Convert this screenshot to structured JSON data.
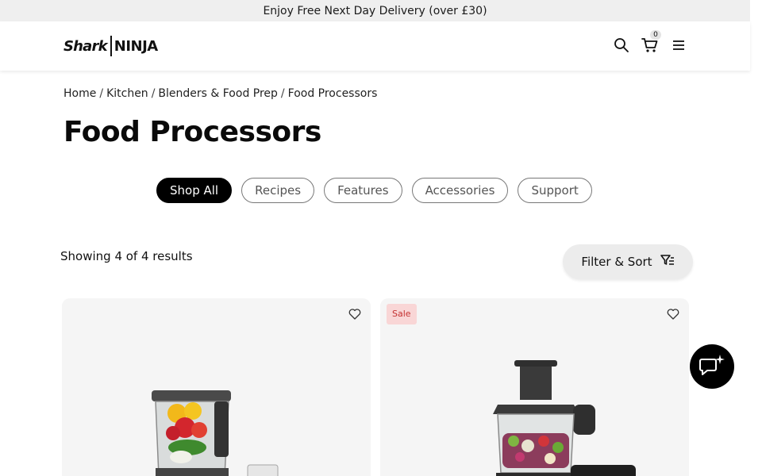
{
  "promo_bar": {
    "text": "Enjoy Free Next Day Delivery (over £30)"
  },
  "header": {
    "logo": {
      "left": "Shark",
      "right": "NINJA"
    },
    "cart_count": "0",
    "icons": [
      "search-icon",
      "cart-icon",
      "menu-icon"
    ]
  },
  "breadcrumb": [
    {
      "label": "Home"
    },
    {
      "label": "Kitchen"
    },
    {
      "label": "Blenders & Food Prep"
    },
    {
      "label": "Food Processors"
    }
  ],
  "page_title": "Food Processors",
  "category_pills": [
    {
      "label": "Shop All",
      "active": true
    },
    {
      "label": "Recipes",
      "active": false
    },
    {
      "label": "Features",
      "active": false
    },
    {
      "label": "Accessories",
      "active": false
    },
    {
      "label": "Support",
      "active": false
    }
  ],
  "results_text": "Showing 4 of 4 results",
  "filter_button": {
    "label": "Filter & Sort",
    "icon": "filter-icon"
  },
  "products": [
    {
      "badge": "",
      "image": "blender-image"
    },
    {
      "badge": "Sale",
      "image": "food-processor-image"
    }
  ],
  "chat": {
    "icon": "chat-sparkle-icon"
  },
  "colors": {
    "badge_bg": "#f9d6d6",
    "badge_text": "#c43131",
    "active_pill": "#000000",
    "card_bg": "#f5f5f5"
  }
}
